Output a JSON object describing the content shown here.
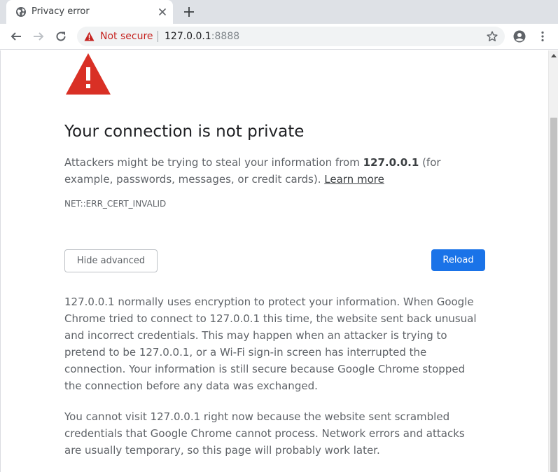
{
  "tab": {
    "title": "Privacy error",
    "favicon": "globe-icon",
    "close_icon": "close-icon"
  },
  "toolbar": {
    "back_icon": "back-arrow-icon",
    "forward_icon": "forward-arrow-icon",
    "reload_icon": "reload-icon",
    "new_tab_icon": "plus-icon",
    "omnibox": {
      "security_label": "Not secure",
      "url_host": "127.0.0.1",
      "url_port": ":8888"
    },
    "bookmark_icon": "star-icon",
    "profile_icon": "account-icon",
    "menu_icon": "more-vert-icon"
  },
  "page": {
    "heading": "Your connection is not private",
    "explanation_prefix": "Attackers might be trying to steal your information from ",
    "explanation_host": "127.0.0.1",
    "explanation_suffix": " (for example, passwords, messages, or credit cards). ",
    "learn_more": "Learn more",
    "error_code": "NET::ERR_CERT_INVALID",
    "hide_advanced_label": "Hide advanced",
    "reload_label": "Reload",
    "details_paragraph_1": "127.0.0.1 normally uses encryption to protect your information. When Google Chrome tried to connect to 127.0.0.1 this time, the website sent back unusual and incorrect credentials. This may happen when an attacker is trying to pretend to be 127.0.0.1, or a Wi-Fi sign-in screen has interrupted the connection. Your information is still secure because Google Chrome stopped the connection before any data was exchanged.",
    "details_paragraph_2": "You cannot visit 127.0.0.1 right now because the website sent scrambled credentials that Google Chrome cannot process. Network errors and attacks are usually temporary, so this page will probably work later."
  },
  "colors": {
    "warning_red": "#d93025",
    "link_button_blue": "#1a73e8",
    "not_secure_text": "#c5221f"
  }
}
